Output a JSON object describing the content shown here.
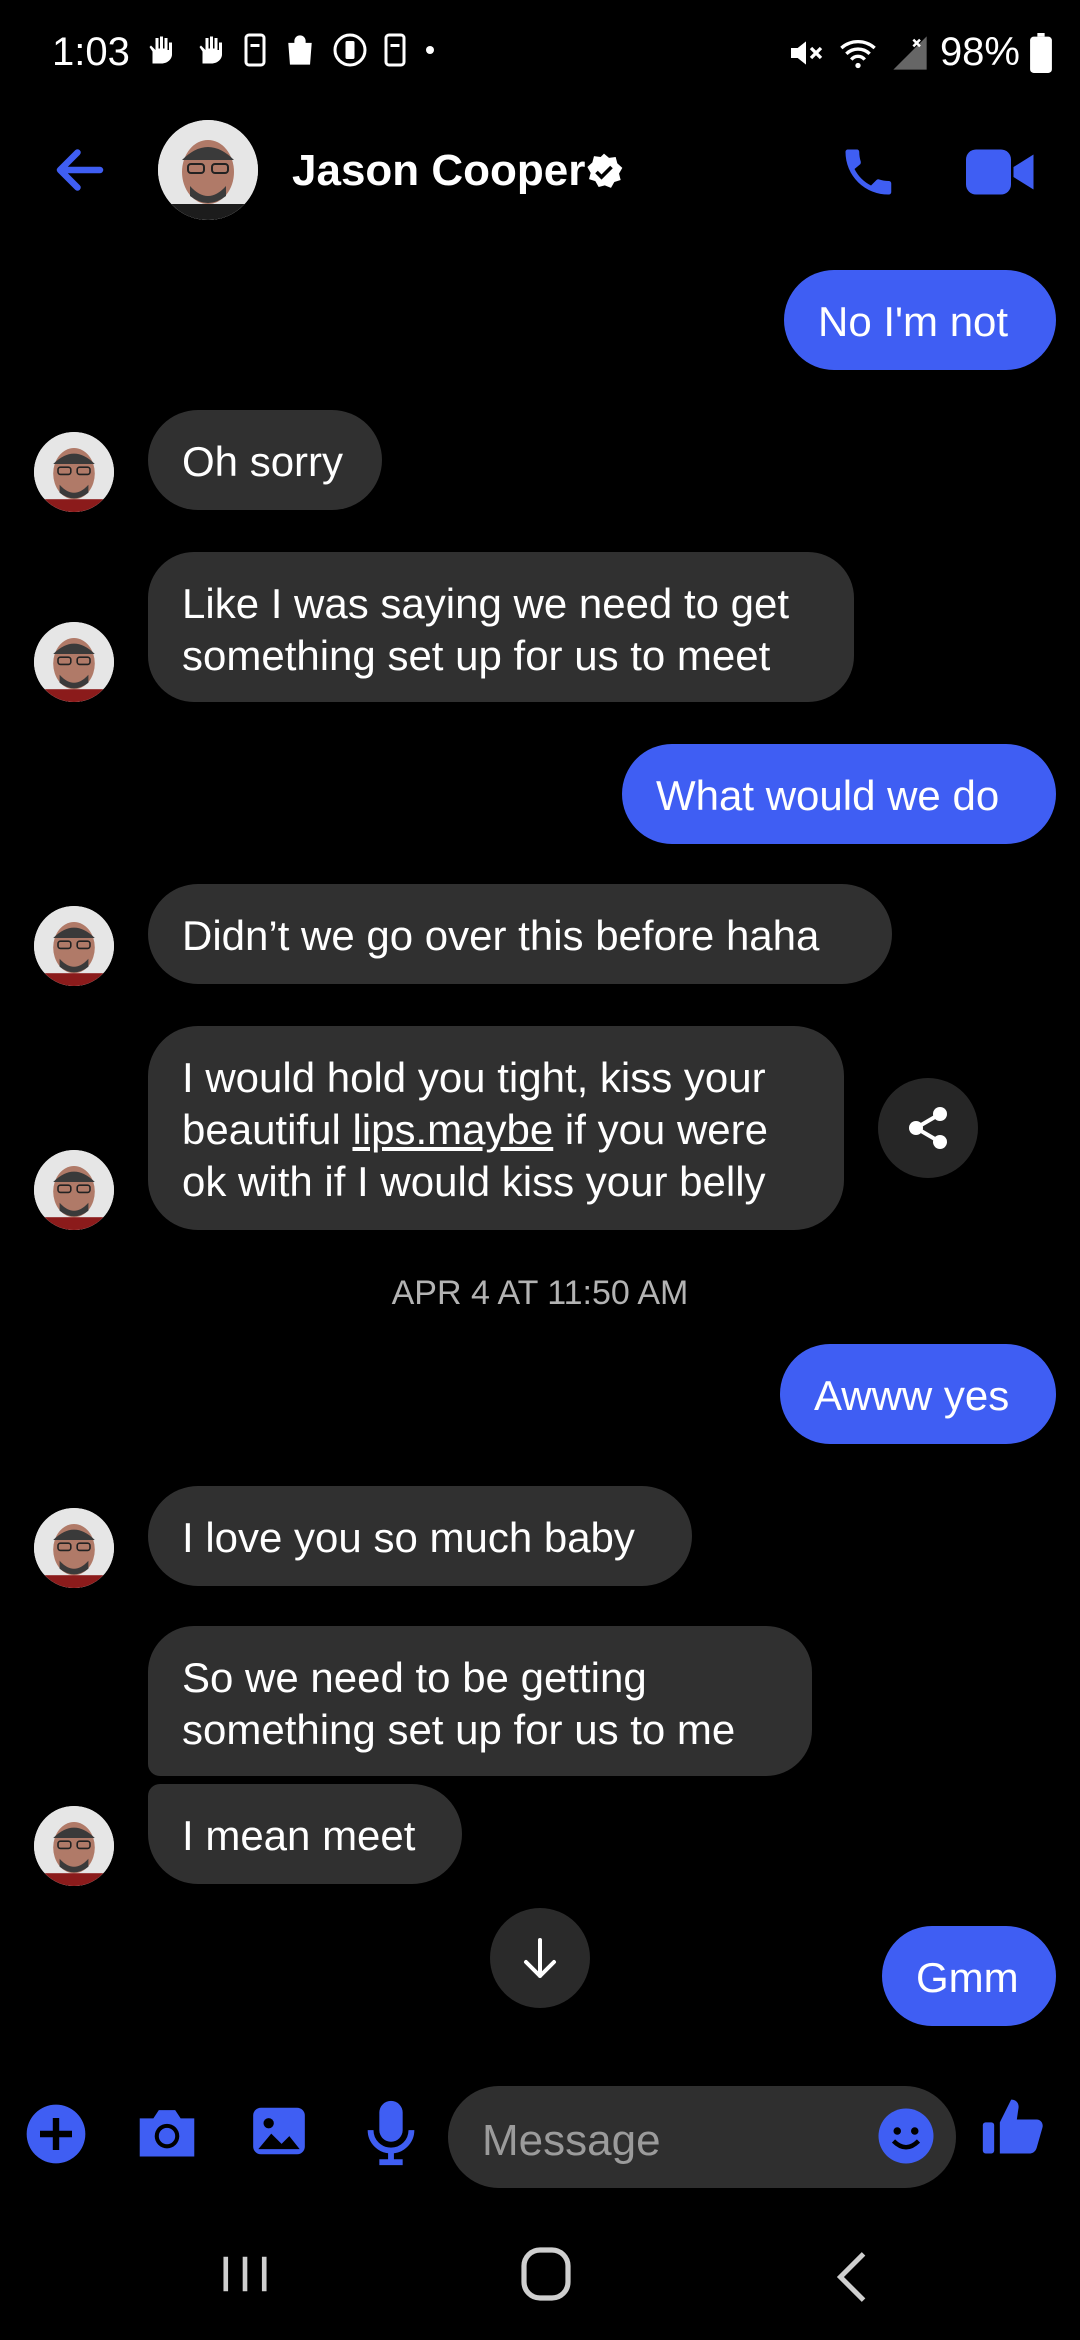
{
  "status_bar": {
    "time": "1:03",
    "battery": "98%"
  },
  "header": {
    "contact_name": "Jason Cooper",
    "icons": [
      "back-arrow-icon",
      "verified-badge-icon",
      "phone-call-icon",
      "video-call-icon"
    ]
  },
  "messages": [
    {
      "from": "me",
      "text": "No I'm not"
    },
    {
      "from": "contact",
      "text": "Oh sorry"
    },
    {
      "from": "contact",
      "text": "Like I was saying we need to get something set up for us to meet"
    },
    {
      "from": "me",
      "text": "What would we do"
    },
    {
      "from": "contact",
      "text": "Didn’t we go over this before haha"
    },
    {
      "from": "contact",
      "text_parts": [
        "I would hold you tight, kiss your beautiful ",
        "lips.maybe",
        " if you were ok with if I would kiss your belly"
      ]
    },
    {
      "from": "me",
      "text": "Awww yes"
    },
    {
      "from": "contact",
      "text": "I love you so much baby"
    },
    {
      "from": "contact",
      "text": "So we need to be getting something set up for us to me"
    },
    {
      "from": "contact",
      "text": "I mean meet"
    },
    {
      "from": "me",
      "text": "Gmm"
    }
  ],
  "timestamp": "APR 4 AT 11:50 AM",
  "composer": {
    "placeholder": "Message",
    "icons": [
      "plus-icon",
      "camera-icon",
      "gallery-icon",
      "microphone-icon",
      "emoji-icon",
      "thumbs-up-icon"
    ]
  },
  "colors": {
    "accent": "#3f5ef3",
    "incoming_bubble": "#303030",
    "background": "#000000"
  }
}
